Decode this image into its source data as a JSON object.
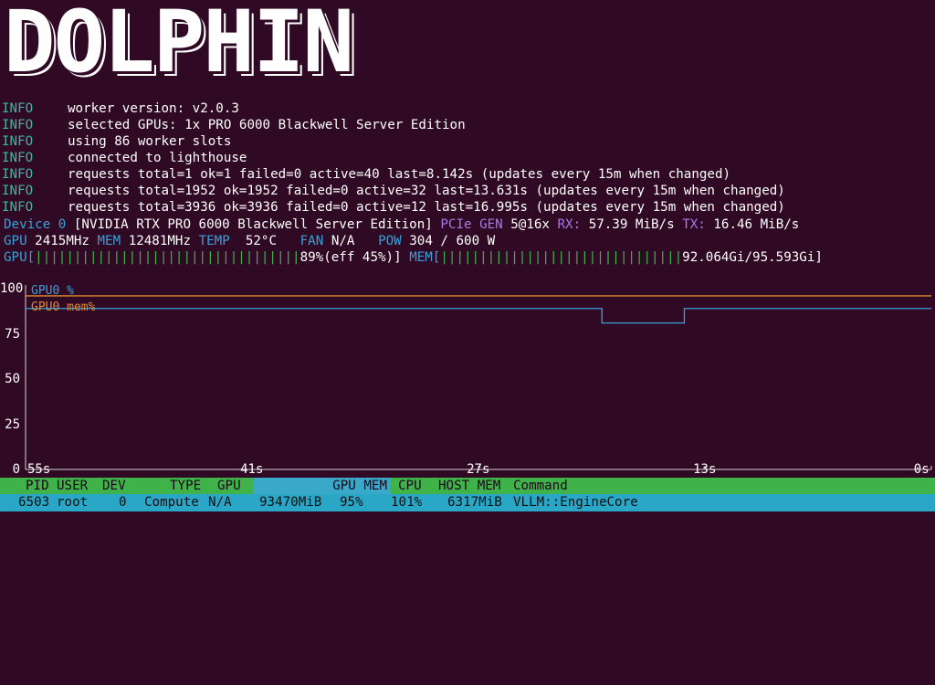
{
  "banner": {
    "text": "DOLPHIN"
  },
  "log": [
    {
      "level": "INFO",
      "message": "worker version: v2.0.3"
    },
    {
      "level": "INFO",
      "message": "selected GPUs: 1x PRO 6000 Blackwell Server Edition"
    },
    {
      "level": "INFO",
      "message": "using 86 worker slots"
    },
    {
      "level": "INFO",
      "message": "connected to lighthouse"
    },
    {
      "level": "INFO",
      "message": "requests total=1 ok=1 failed=0 active=40 last=8.142s (updates every 15m when changed)"
    },
    {
      "level": "INFO",
      "message": "requests total=1952 ok=1952 failed=0 active=32 last=13.631s (updates every 15m when changed)"
    },
    {
      "level": "INFO",
      "message": "requests total=3936 ok=3936 failed=0 active=12 last=16.995s (updates every 15m when changed)"
    }
  ],
  "device": {
    "label": "Device 0",
    "name": "[NVIDIA RTX PRO 6000 Blackwell Server Edition]",
    "pcie_label": "PCIe GEN",
    "pcie_value": "5@16x",
    "rx_label": "RX:",
    "rx_value": "57.39 MiB/s",
    "tx_label": "TX:",
    "tx_value": "16.46 MiB/s"
  },
  "stats": {
    "gpu_label": "GPU",
    "gpu_clock": "2415MHz",
    "mem_label": "MEM",
    "mem_clock": "12481MHz",
    "temp_label": "TEMP",
    "temp_value": "52°C",
    "fan_label": "FAN",
    "fan_value": "N/A",
    "pow_label": "POW",
    "pow_value": "304 / 600 W"
  },
  "bars": {
    "gpu_label": "GPU[",
    "gpu_fill": "||||||||||||||||||||||||||||||||||",
    "gpu_text": "89%(eff 45%)",
    "gpu_close": "]",
    "gpu_fraction": 0.89,
    "mem_label": "MEM[",
    "mem_fill": "|||||||||||||||||||||||||||||||",
    "mem_text": "92.064Gi/95.593Gi",
    "mem_close": "]",
    "mem_fraction": 0.963
  },
  "chart_data": {
    "type": "line",
    "yticks": [
      "100",
      "75",
      "50",
      "25",
      "0"
    ],
    "ylim": [
      0,
      100
    ],
    "xticks": [
      "55s",
      "41s",
      "27s",
      "13s",
      "0s"
    ],
    "xlim": [
      55,
      0
    ],
    "series": [
      {
        "name": "GPU0 %",
        "color": "#3aa0d8",
        "points": [
          [
            55,
            89
          ],
          [
            20,
            89
          ],
          [
            20,
            81
          ],
          [
            15,
            81
          ],
          [
            15,
            89
          ],
          [
            0,
            89
          ]
        ]
      },
      {
        "name": "GPU0 mem%",
        "color": "#e08a2c",
        "points": [
          [
            55,
            96
          ],
          [
            0,
            96
          ]
        ]
      }
    ]
  },
  "proc_header": {
    "pid": "PID",
    "user": "USER",
    "dev": "DEV",
    "type": "TYPE",
    "gpu": "GPU",
    "gpu_mem": "GPU MEM",
    "cpu": "CPU",
    "host_mem": "HOST MEM",
    "command": "Command"
  },
  "processes": [
    {
      "pid": "6503",
      "user": "root",
      "dev": "0",
      "type": "Compute",
      "gpu": "N/A",
      "gpu_mem": "93470MiB",
      "gpu_mem_pct": "95%",
      "cpu": "101%",
      "host_mem": "6317MiB",
      "command": "VLLM::EngineCore"
    }
  ],
  "colors": {
    "background": "#300a24",
    "info": "#3fb5a0",
    "accent_blue": "#3aa0d8",
    "accent_purple": "#a77ae6",
    "bar_green": "#3fb34a",
    "mem_orange": "#e08a2c"
  }
}
